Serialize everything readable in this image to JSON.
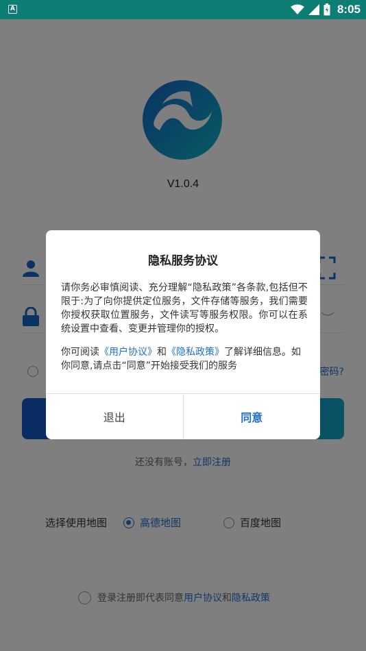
{
  "status": {
    "time": "8:05"
  },
  "app": {
    "version": "V1.0.4"
  },
  "login": {
    "forgot": "密码?",
    "register_prefix": "还没有账号，",
    "register_link": "立即注册"
  },
  "map": {
    "label": "选择使用地图",
    "options": [
      "高德地图",
      "百度地图"
    ],
    "selected": "高德地图"
  },
  "agreement": {
    "prefix": "登录注册即代表同意",
    "user_link": "用户协议",
    "and": "和",
    "privacy_link": "隐私政策"
  },
  "dialog": {
    "title": "隐私服务协议",
    "body": "请你务必审慎阅读、充分理解“隐私政策”各条款,包括但不限于:为了向你提供定位服务，文件存储等服务，我们需要你授权获取位置服务，文件读写等服务权限。你可以在系统设置中查看、变更并管理你的授权。",
    "read_prefix": "你可阅读",
    "user_agreement": "《用户协议》",
    "and": "和",
    "privacy_policy": "《隐私政策》",
    "read_suffix": "了解详细信息。如你同意,请点击“同意”开始接受我们的服务",
    "exit_label": "退出",
    "agree_label": "同意"
  },
  "colors": {
    "accent": "#1e6fd0",
    "statusbar": "#0c7e74"
  }
}
